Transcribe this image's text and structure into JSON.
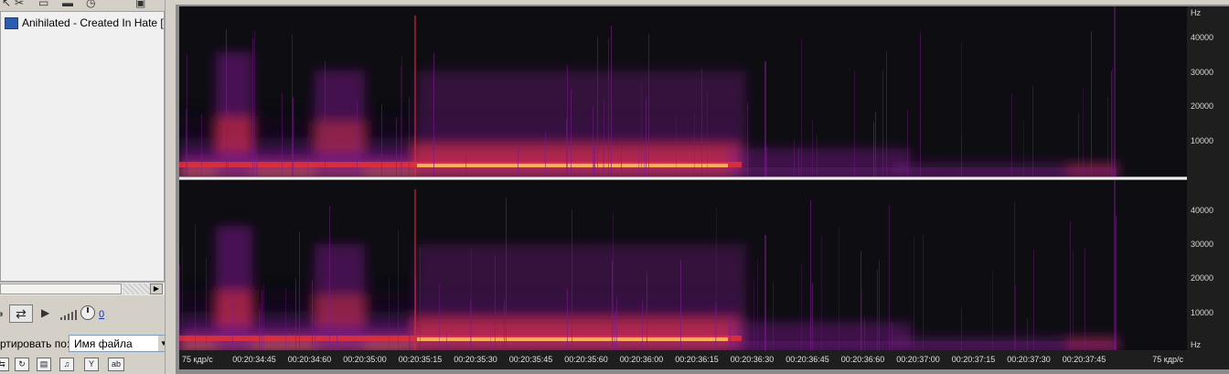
{
  "left_panel": {
    "file_item_label": "Anihilated - Created In Hate [Side",
    "volume_value": "0",
    "sort_label": "ртировать по:",
    "sort_value": "Имя файла",
    "top_toolbar_icons": [
      "pointer-icon",
      "cut-icon",
      "waveform-view-icon",
      "keyboard-icon",
      "clock-icon",
      "window-icon"
    ],
    "bottom_tools": [
      "loop-tool-icon",
      "refresh-icon",
      "film-icon",
      "music-note-icon",
      "filter-icon",
      "text-tool-icon"
    ]
  },
  "spectrogram": {
    "freq_unit": "Hz",
    "freq_ticks": [
      "40000",
      "30000",
      "20000",
      "10000"
    ],
    "freq_unit_bottom": "Hz",
    "time_start_label": "75 кдр/с",
    "time_end_label": "75 кдр/с",
    "time_ticks": [
      "00:20:34:45",
      "00:20:34:60",
      "00:20:35:00",
      "00:20:35:15",
      "00:20:35:30",
      "00:20:35:45",
      "00:20:35:60",
      "00:20:36:00",
      "00:20:36:15",
      "00:20:36:30",
      "00:20:36:45",
      "00:20:36:60",
      "00:20:37:00",
      "00:20:37:15",
      "00:20:37:30",
      "00:20:37:45"
    ],
    "colors": {
      "low": "#1a0a2a",
      "mid": "#7a1a8a",
      "high": "#e0303a",
      "peak": "#ffd060"
    }
  }
}
